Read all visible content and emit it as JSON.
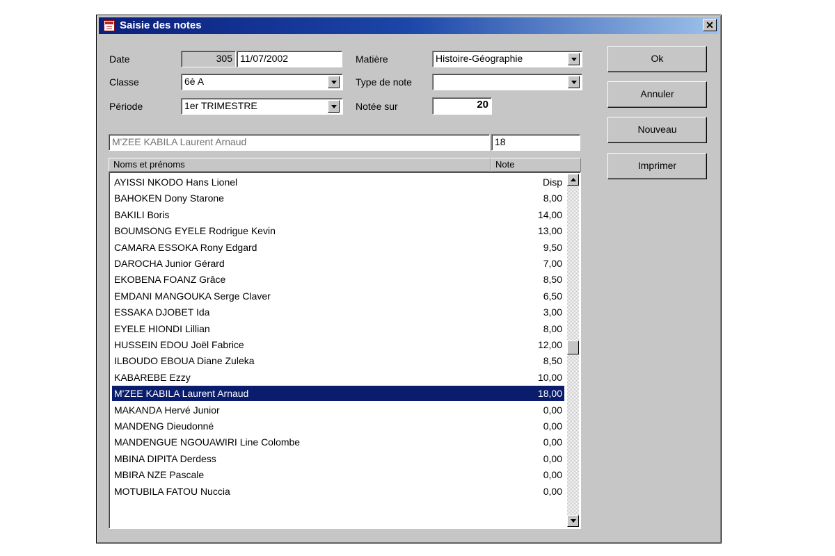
{
  "window": {
    "title": "Saisie des notes",
    "close_label": "✕",
    "icon": "notebook-icon"
  },
  "form": {
    "date_label": "Date",
    "date_number": "305",
    "date_value": "11/07/2002",
    "classe_label": "Classe",
    "classe_value": "6è A",
    "periode_label": "Période",
    "periode_value": "1er TRIMESTRE",
    "matiere_label": "Matière",
    "matiere_value": "Histoire-Géographie",
    "type_label": "Type de note",
    "type_value": "",
    "notee_label": "Notée sur",
    "notee_value": "20"
  },
  "buttons": {
    "ok": "Ok",
    "annuler": "Annuler",
    "nouveau": "Nouveau",
    "imprimer": "Imprimer"
  },
  "current": {
    "name": "M'ZEE KABILA Laurent Arnaud",
    "note": "18"
  },
  "list": {
    "header_name": "Noms et prénoms",
    "header_note": "Note",
    "selected_index": 13,
    "rows": [
      {
        "name": "AYISSI NKODO Hans Lionel",
        "note": "Disp"
      },
      {
        "name": "BAHOKEN Dony Starone",
        "note": "8,00"
      },
      {
        "name": "BAKILI Boris",
        "note": "14,00"
      },
      {
        "name": "BOUMSONG EYELE Rodrigue Kevin",
        "note": "13,00"
      },
      {
        "name": "CAMARA ESSOKA Rony Edgard",
        "note": "9,50"
      },
      {
        "name": "DAROCHA Junior Gérard",
        "note": "7,00"
      },
      {
        "name": "EKOBENA FOANZ Grâce",
        "note": "8,50"
      },
      {
        "name": "EMDANI MANGOUKA Serge  Claver",
        "note": "6,50"
      },
      {
        "name": "ESSAKA DJOBET Ida",
        "note": "3,00"
      },
      {
        "name": "EYELE HIONDI Lillian",
        "note": "8,00"
      },
      {
        "name": "HUSSEIN EDOU Joël Fabrice",
        "note": "12,00"
      },
      {
        "name": "ILBOUDO EBOUA Diane Zuleka",
        "note": "8,50"
      },
      {
        "name": "KABAREBE Ezzy",
        "note": "10,00"
      },
      {
        "name": "M'ZEE KABILA Laurent Arnaud",
        "note": "18,00"
      },
      {
        "name": "MAKANDA Hervé Junior",
        "note": "0,00"
      },
      {
        "name": "MANDENG Dieudonné",
        "note": "0,00"
      },
      {
        "name": "MANDENGUE NGOUAWIRI Line Colombe",
        "note": "0,00"
      },
      {
        "name": "MBINA DIPITA Derdess",
        "note": "0,00"
      },
      {
        "name": "MBIRA NZE Pascale",
        "note": "0,00"
      },
      {
        "name": "MOTUBILA FATOU Nuccia",
        "note": "0,00"
      }
    ]
  }
}
